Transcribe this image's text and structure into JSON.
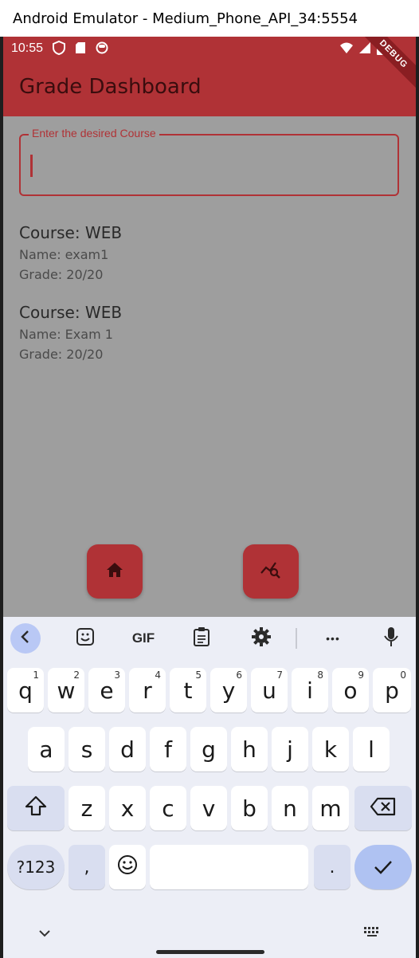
{
  "window": {
    "title": "Android Emulator - Medium_Phone_API_34:5554"
  },
  "status_bar": {
    "time": "10:55"
  },
  "app_bar": {
    "title": "Grade Dashboard",
    "debug_banner": "DEBUG"
  },
  "course_field": {
    "label": "Enter the desired Course",
    "value": ""
  },
  "grades": [
    {
      "course": "Course: WEB",
      "name": "Name: exam1",
      "grade": "Grade: 20/20"
    },
    {
      "course": "Course: WEB",
      "name": "Name: Exam 1",
      "grade": "Grade: 20/20"
    }
  ],
  "fab": {
    "home_icon": "home-icon",
    "analytics_icon": "query-stats-icon"
  },
  "keyboard": {
    "toolbar": {
      "gif_label": "GIF",
      "more_label": "•••"
    },
    "row1": [
      {
        "key": "q",
        "hint": "1"
      },
      {
        "key": "w",
        "hint": "2"
      },
      {
        "key": "e",
        "hint": "3"
      },
      {
        "key": "r",
        "hint": "4"
      },
      {
        "key": "t",
        "hint": "5"
      },
      {
        "key": "y",
        "hint": "6"
      },
      {
        "key": "u",
        "hint": "7"
      },
      {
        "key": "i",
        "hint": "8"
      },
      {
        "key": "o",
        "hint": "9"
      },
      {
        "key": "p",
        "hint": "0"
      }
    ],
    "row2": [
      "a",
      "s",
      "d",
      "f",
      "g",
      "h",
      "j",
      "k",
      "l"
    ],
    "row3": [
      "z",
      "x",
      "c",
      "v",
      "b",
      "n",
      "m"
    ],
    "sym_label": "?123",
    "comma_label": ",",
    "period_label": "."
  },
  "colors": {
    "primary": "#b03236",
    "scrim_background": "#9e9e9e",
    "keyboard_background": "#eceef6"
  }
}
